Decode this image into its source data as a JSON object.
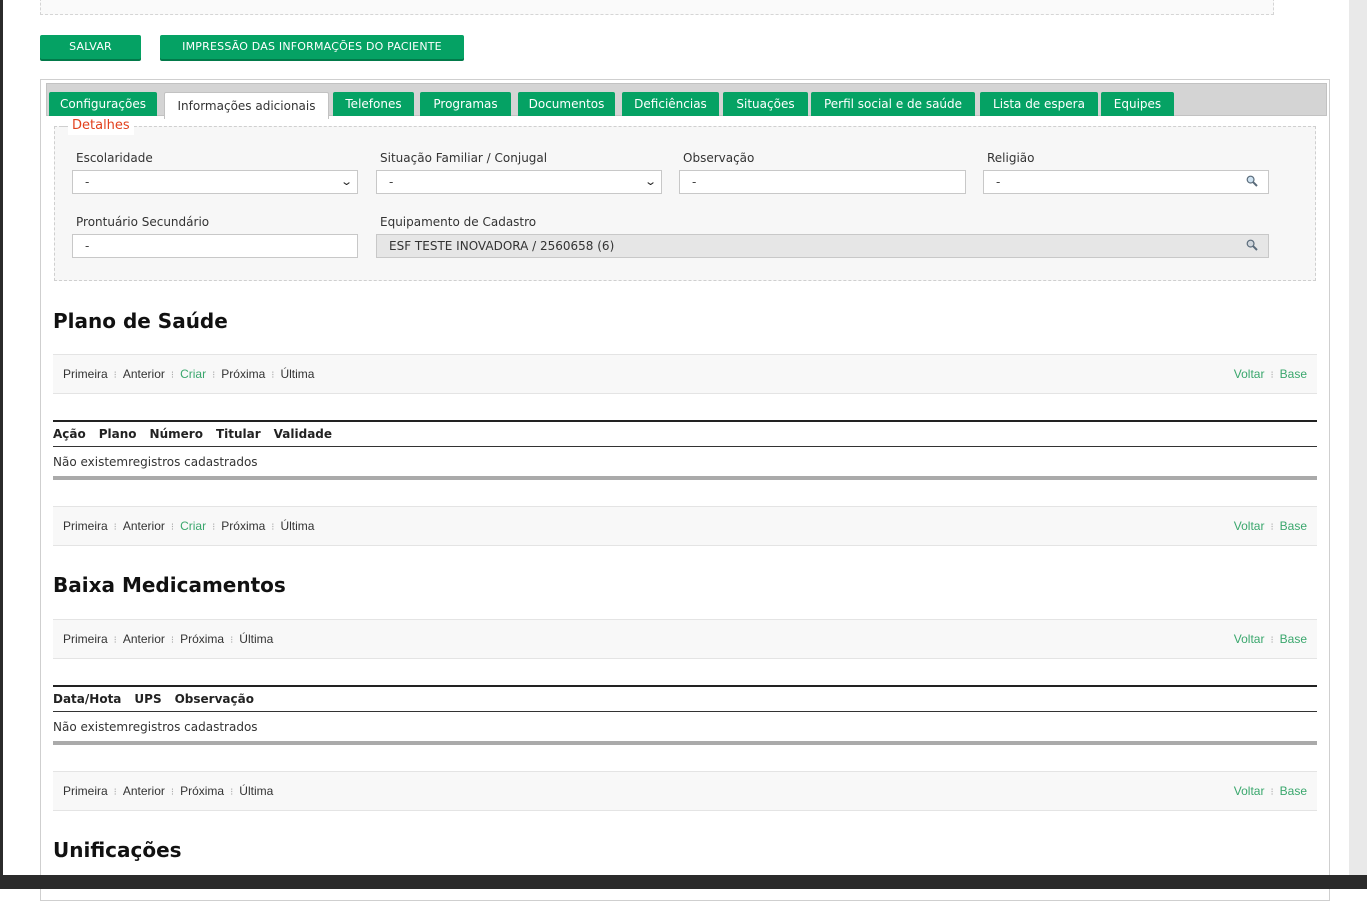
{
  "toolbar": {
    "save_label": "SALVAR",
    "print_label": "IMPRESSÃO DAS INFORMAÇÕES DO PACIENTE"
  },
  "tabs": [
    {
      "label": "Configurações"
    },
    {
      "label": "Informações adicionais",
      "active": true
    },
    {
      "label": "Telefones"
    },
    {
      "label": "Programas"
    },
    {
      "label": "Documentos"
    },
    {
      "label": "Deficiências"
    },
    {
      "label": "Situações"
    },
    {
      "label": "Perfil social e de saúde"
    },
    {
      "label": "Lista de espera"
    },
    {
      "label": "Equipes"
    }
  ],
  "details": {
    "legend": "Detalhes",
    "escolaridade": {
      "label": "Escolaridade",
      "value": "-"
    },
    "situacao_familiar": {
      "label": "Situação Familiar / Conjugal",
      "value": "-"
    },
    "observacao": {
      "label": "Observação",
      "value": "-"
    },
    "religiao": {
      "label": "Religião",
      "value": "-"
    },
    "prontuario_secundario": {
      "label": "Prontuário Secundário",
      "value": "-"
    },
    "equipamento_cadastro": {
      "label": "Equipamento de Cadastro",
      "value": "ESF TESTE INOVADORA / 2560658 (6)"
    }
  },
  "pager": {
    "first": "Primeira",
    "previous": "Anterior",
    "create": "Criar",
    "next": "Próxima",
    "last": "Última",
    "back": "Voltar",
    "base": "Base",
    "link_color": "#3aa76d"
  },
  "plano_saude": {
    "title": "Plano de Saúde",
    "columns": [
      "Ação",
      "Plano",
      "Número",
      "Titular",
      "Validade"
    ],
    "empty_text": "Não existemregistros cadastrados"
  },
  "baixa_medicamentos": {
    "title": "Baixa Medicamentos",
    "columns": [
      "Data/Hota",
      "UPS",
      "Observação"
    ],
    "empty_text": "Não existemregistros cadastrados"
  },
  "unificacoes": {
    "title": "Unificações"
  },
  "colors": {
    "primary": "#05a264",
    "legend": "#e2401c"
  }
}
